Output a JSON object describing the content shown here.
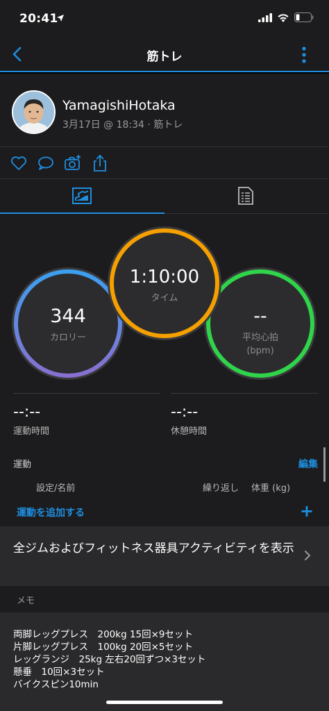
{
  "status": {
    "time": "20:41"
  },
  "nav": {
    "title": "筋トレ"
  },
  "user": {
    "name": "YamagishiHotaka",
    "meta": "3月17日 @ 18:34 · 筋トレ"
  },
  "stats": {
    "calories": {
      "value": "344",
      "label": "カロリー"
    },
    "time": {
      "value": "1:10:00",
      "label": "タイム"
    },
    "heart_rate": {
      "value": "--",
      "label_line1": "平均心拍",
      "label_line2": "(bpm)"
    }
  },
  "durations": {
    "active": {
      "value": "--:--",
      "label": "運動時間"
    },
    "rest": {
      "value": "--:--",
      "label": "休憩時間"
    }
  },
  "exercise": {
    "title": "運動",
    "edit_label": "編集",
    "columns": [
      "設定/名前",
      "繰り返し",
      "体重 (kg)"
    ],
    "add_label": "運動を追加する",
    "add_symbol": "+"
  },
  "gym_link": {
    "text": "全ジムおよびフィットネス器具アクティビティを表示"
  },
  "memo": {
    "header": "メモ",
    "lines": [
      "両脚レッグプレス　200kg 15回×9セット",
      "片脚レッグプレス　100kg 20回×5セット",
      "レッグランジ　25kg 左右20回ずつ×3セット",
      "懸垂　10回×3セット",
      "バイクスピン10min"
    ]
  },
  "colors": {
    "accent": "#1e8fe0",
    "calorie_ring_start": "#3aa0f0",
    "calorie_ring_end": "#8a6fd1",
    "time_ring": "#f5a000",
    "heart_ring": "#2fd44a"
  },
  "icons": [
    "location-arrow-icon",
    "signal-icon",
    "wifi-icon",
    "battery-icon",
    "back-chevron-icon",
    "more-vertical-icon",
    "heart-icon",
    "comment-icon",
    "camera-icon",
    "share-icon",
    "stats-tab-icon",
    "details-tab-icon",
    "chevron-right-icon"
  ]
}
